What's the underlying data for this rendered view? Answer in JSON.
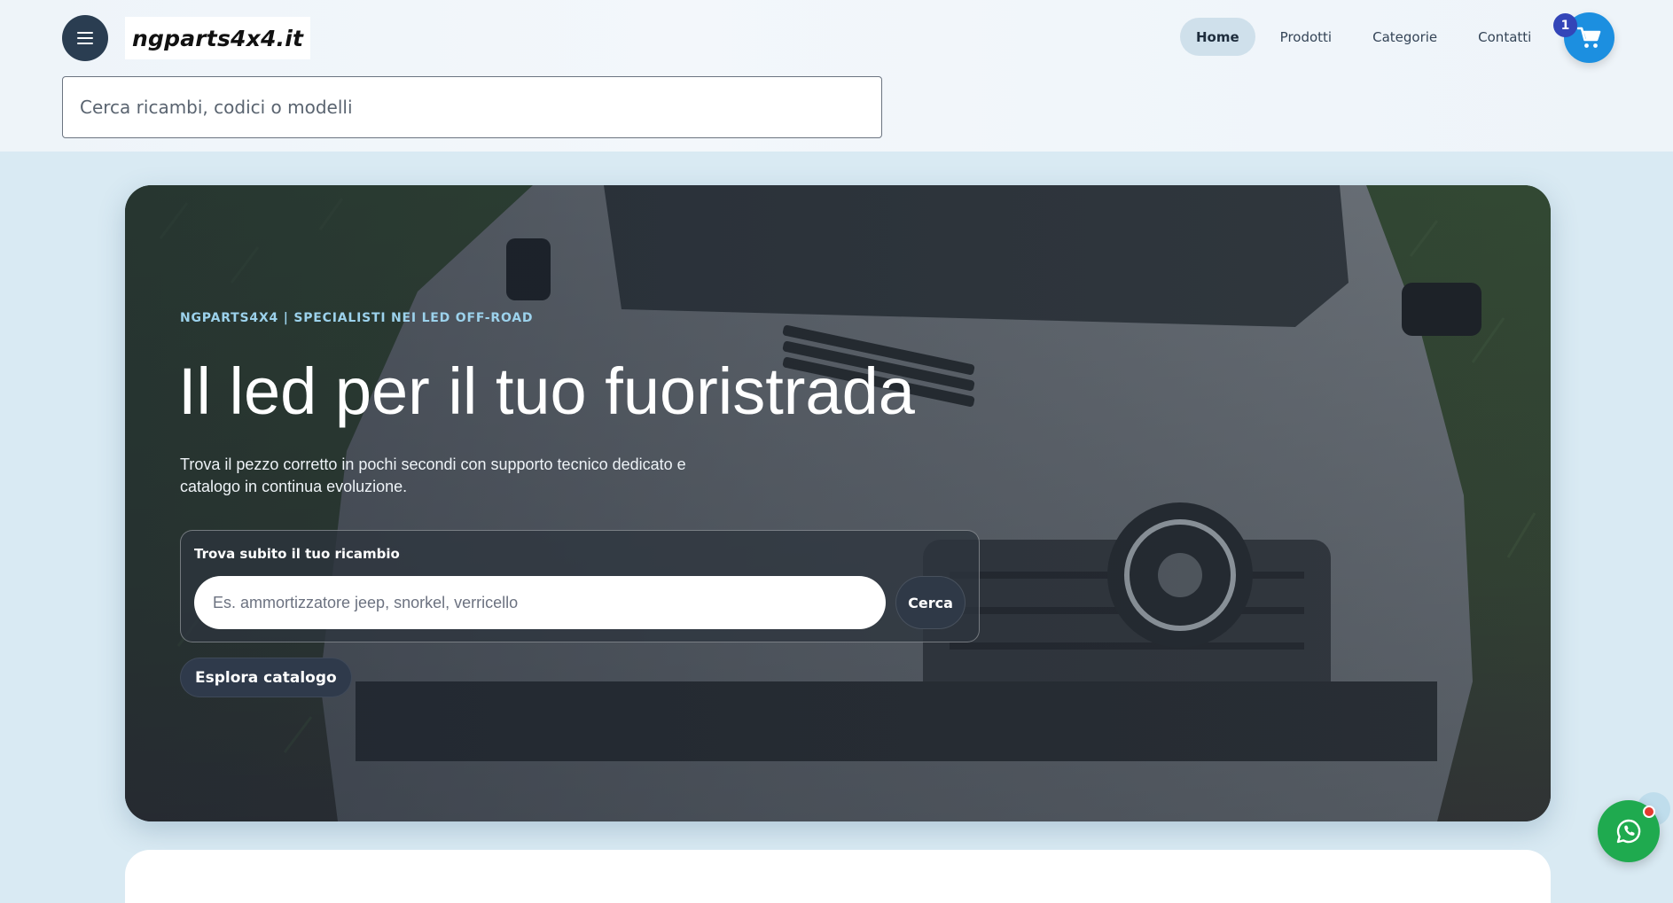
{
  "header": {
    "brand": "ngparts4x4.it",
    "search_placeholder": "Cerca ricambi, codici o modelli",
    "nav": [
      {
        "label": "Home",
        "active": true
      },
      {
        "label": "Prodotti",
        "active": false
      },
      {
        "label": "Categorie",
        "active": false
      },
      {
        "label": "Contatti",
        "active": false
      }
    ],
    "cart_count": "1",
    "icons": {
      "menu": "hamburger-icon",
      "cart": "cart-icon"
    }
  },
  "hero": {
    "eyebrow": "NGPARTS4X4 | SPECIALISTI NEI LED OFF-ROAD",
    "title": "Il led per il tuo fuoristrada",
    "subtitle": "Trova il pezzo corretto in pochi secondi con supporto tecnico dedicato e catalogo in continua evoluzione.",
    "finder": {
      "label": "Trova subito il tuo ricambio",
      "placeholder": "Es. ammortizzatore jeep, snorkel, verricello",
      "button": "Cerca"
    },
    "explore_button": "Esplora catalogo"
  },
  "floating": {
    "whatsapp_icon": "whatsapp-icon",
    "notification": true
  },
  "colors": {
    "nav_active_bg": "#cfe0eb",
    "cart": "#1c8fe0",
    "badge": "#3345b8",
    "eyebrow": "#9cd2ec",
    "whatsapp": "#1faa4f",
    "notification_dot": "#e33a2f"
  }
}
